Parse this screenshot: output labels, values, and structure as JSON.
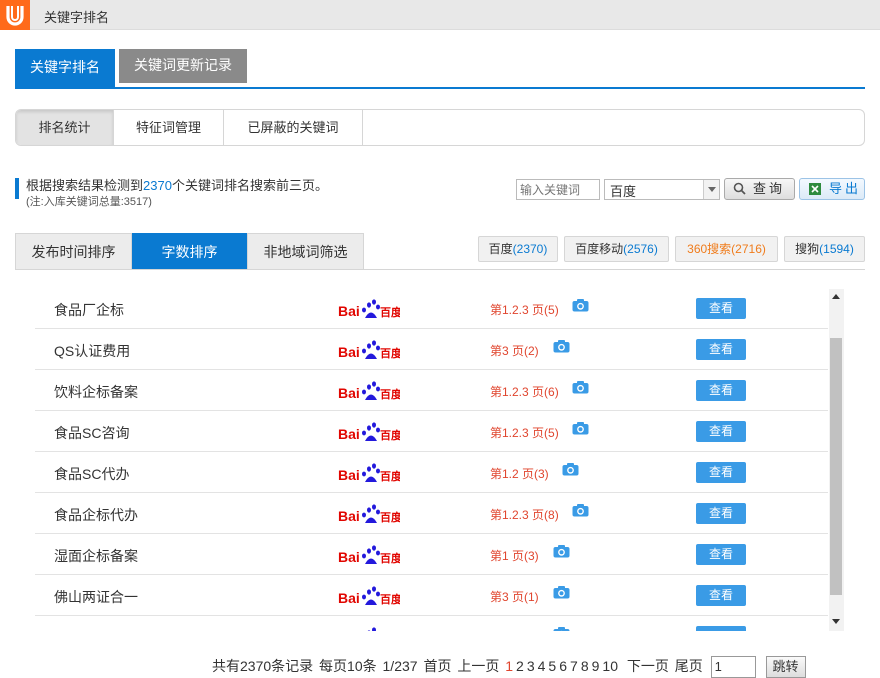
{
  "window": {
    "title": "关键字排名"
  },
  "topnav": {
    "tab_rank": "关键字排名",
    "tab_update": "关键词更新记录"
  },
  "subtabs": [
    "排名统计",
    "特征词管理",
    "已屏蔽的关键词"
  ],
  "summary": {
    "prefix": "根据搜索结果检测到",
    "count": "2370",
    "suffix": "个关键词排名搜索前三页。",
    "note": "(注:入库关键词总量:3517)"
  },
  "search": {
    "placeholder": "输入关键词",
    "engine_selected": "百度",
    "search_label": "查询",
    "export_label": "导出"
  },
  "sort_tabs": [
    "发布时间排序",
    "字数排序",
    "非地域词筛选"
  ],
  "engine_tabs": [
    {
      "name": "百度",
      "count": "(2370)"
    },
    {
      "name": "百度移动",
      "count": "(2576)"
    },
    {
      "name": "360搜索",
      "count": "(2716)"
    },
    {
      "name": "搜狗",
      "count": "(1594)"
    }
  ],
  "engine_logo": {
    "text_bai": "Bai",
    "text_du": "百度",
    "color_red": "#e10601",
    "color_blue": "#2319dc"
  },
  "rows": [
    {
      "keyword": "食品厂企标",
      "rank": "第1.2.3 页(5)",
      "action": "查看"
    },
    {
      "keyword": "QS认证费用",
      "rank": "第3 页(2)",
      "action": "查看"
    },
    {
      "keyword": "饮料企标备案",
      "rank": "第1.2.3 页(6)",
      "action": "查看"
    },
    {
      "keyword": "食品SC咨询",
      "rank": "第1.2.3 页(5)",
      "action": "查看"
    },
    {
      "keyword": "食品SC代办",
      "rank": "第1.2 页(3)",
      "action": "查看"
    },
    {
      "keyword": "食品企标代办",
      "rank": "第1.2.3 页(8)",
      "action": "查看"
    },
    {
      "keyword": "湿面企标备案",
      "rank": "第1 页(3)",
      "action": "查看"
    },
    {
      "keyword": "佛山两证合一",
      "rank": "第3 页(1)",
      "action": "查看"
    },
    {
      "keyword": "",
      "rank": "",
      "action": ""
    }
  ],
  "pager": {
    "total": "共有2370条记录",
    "per_page": "每页10条",
    "position": "1/237",
    "first": "首页",
    "prev": "上一页",
    "pages": [
      "1",
      "2",
      "3",
      "4",
      "5",
      "6",
      "7",
      "8",
      "9",
      "10"
    ],
    "current_page": "1",
    "next": "下一页",
    "last": "尾页",
    "jump_value": "1",
    "jump_label": "跳转"
  },
  "colors": {
    "accent": "#0a7ad1",
    "rank_red": "#e0452e",
    "orange": "#f07c1c",
    "view_button": "#3a9be6"
  }
}
